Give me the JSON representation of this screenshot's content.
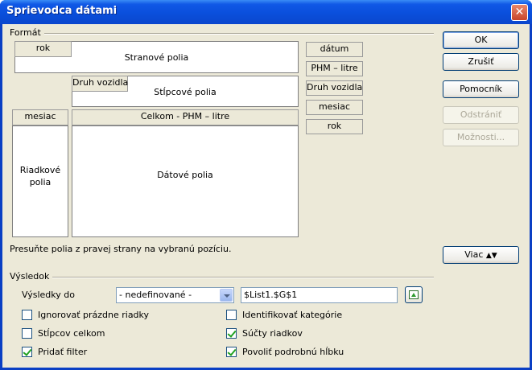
{
  "window": {
    "title": "Sprievodca dátami",
    "close_symbol": "✕"
  },
  "format": {
    "group_label": "Formát",
    "page_area": {
      "label": "Stranové polia",
      "field": "rok"
    },
    "column_area": {
      "label": "Stĺpcové polia",
      "field": "Druh vozidla"
    },
    "row_area": {
      "label": "Riadkové polia",
      "field": "mesiac"
    },
    "data_area": {
      "label": "Dátové polia",
      "field": "Celkom - PHM – litre"
    },
    "available_fields": [
      "dátum",
      "PHM – litre",
      "Druh vozidla",
      "mesiac",
      "rok"
    ],
    "hint": "Presuňte polia z pravej strany na vybranú pozíciu."
  },
  "buttons": {
    "ok": "OK",
    "cancel": "Zrušiť",
    "help": "Pomocník",
    "remove": "Odstrániť",
    "options": "Možnosti...",
    "more": "Viac",
    "more_arrows": "▲▼"
  },
  "result": {
    "group_label": "Výsledok",
    "results_to_label": "Výsledky do",
    "destination_select": "- nedefinované -",
    "destination_value": "$List1.$G$1",
    "checkboxes": {
      "ignore_empty": {
        "label": "Ignorovať prázdne riadky",
        "checked": false
      },
      "identify_categories": {
        "label": "Identifikovať kategórie",
        "checked": false
      },
      "column_totals": {
        "label": "Stĺpcov celkom",
        "checked": false
      },
      "row_totals": {
        "label": "Súčty riadkov",
        "checked": true
      },
      "add_filter": {
        "label": "Pridať filter",
        "checked": true
      },
      "enable_drilldown": {
        "label": "Povoliť podrobnú hĺbku",
        "checked": true
      }
    }
  }
}
